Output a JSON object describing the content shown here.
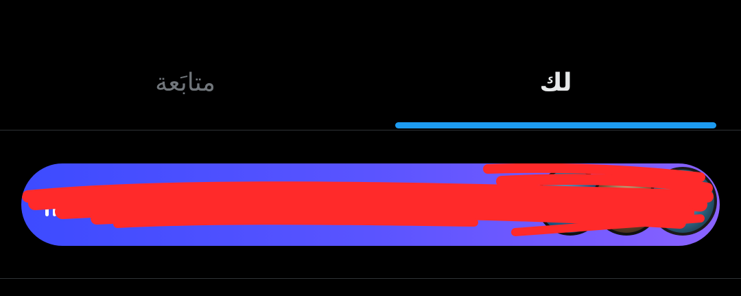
{
  "tabs": {
    "for_you": "لك",
    "following": "متابَعة",
    "active": "for_you"
  },
  "colors": {
    "background": "#000000",
    "active_text": "#e7e9ea",
    "inactive_text": "#71767b",
    "indicator": "#1d9bf0",
    "divider": "#2f3336",
    "pill_gradient_start": "#3d4bff",
    "pill_gradient_end": "#8a63ff",
    "redaction": "#ff2a2a"
  },
  "spaces_banner": {
    "icon": "audio-wave-icon",
    "avatars": [
      "avatar",
      "avatar",
      "avatar"
    ]
  }
}
